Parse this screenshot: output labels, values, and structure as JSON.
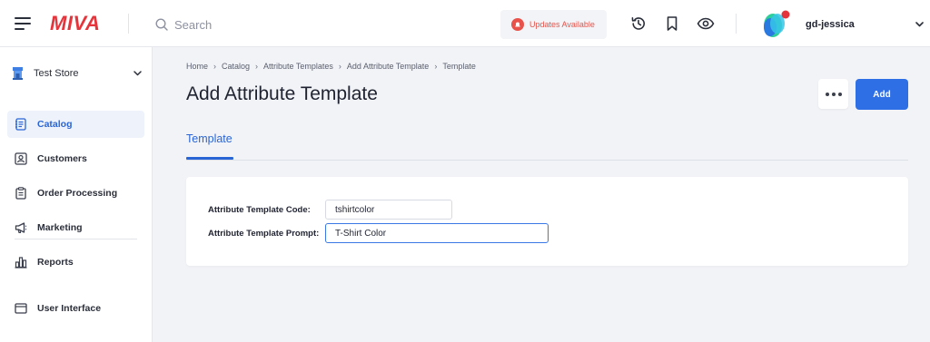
{
  "header": {
    "logo_text": "MIVA",
    "search_placeholder": "Search",
    "updates_label": "Updates Available",
    "username": "gd-jessica",
    "icons": [
      "menu-icon",
      "search-icon",
      "alert-icon",
      "history-icon",
      "bookmark-icon",
      "eye-icon",
      "avatar",
      "chevron-down-icon"
    ]
  },
  "sidebar": {
    "store_name": "Test Store",
    "items": [
      {
        "label": "Catalog",
        "icon": "catalog-icon",
        "active": true
      },
      {
        "label": "Customers",
        "icon": "customers-icon",
        "active": false
      },
      {
        "label": "Order Processing",
        "icon": "clipboard-icon",
        "active": false
      },
      {
        "label": "Marketing",
        "icon": "megaphone-icon",
        "active": false
      },
      {
        "label": "Reports",
        "icon": "bar-chart-icon",
        "active": false
      },
      {
        "label": "User Interface",
        "icon": "window-icon",
        "active": false
      }
    ]
  },
  "breadcrumb": [
    "Home",
    "Catalog",
    "Attribute Templates",
    "Add Attribute Template",
    "Template"
  ],
  "page": {
    "title": "Add Attribute Template",
    "add_label": "Add",
    "tab_label": "Template"
  },
  "form": {
    "code_label": "Attribute Template Code:",
    "code_value": "tshirtcolor",
    "prompt_label": "Attribute Template Prompt:",
    "prompt_value": "T-Shirt Color"
  },
  "colors": {
    "brand": "#e5353c",
    "accent": "#2f6fe6",
    "active_text": "#2a65d6",
    "alert": "#e8524a"
  }
}
